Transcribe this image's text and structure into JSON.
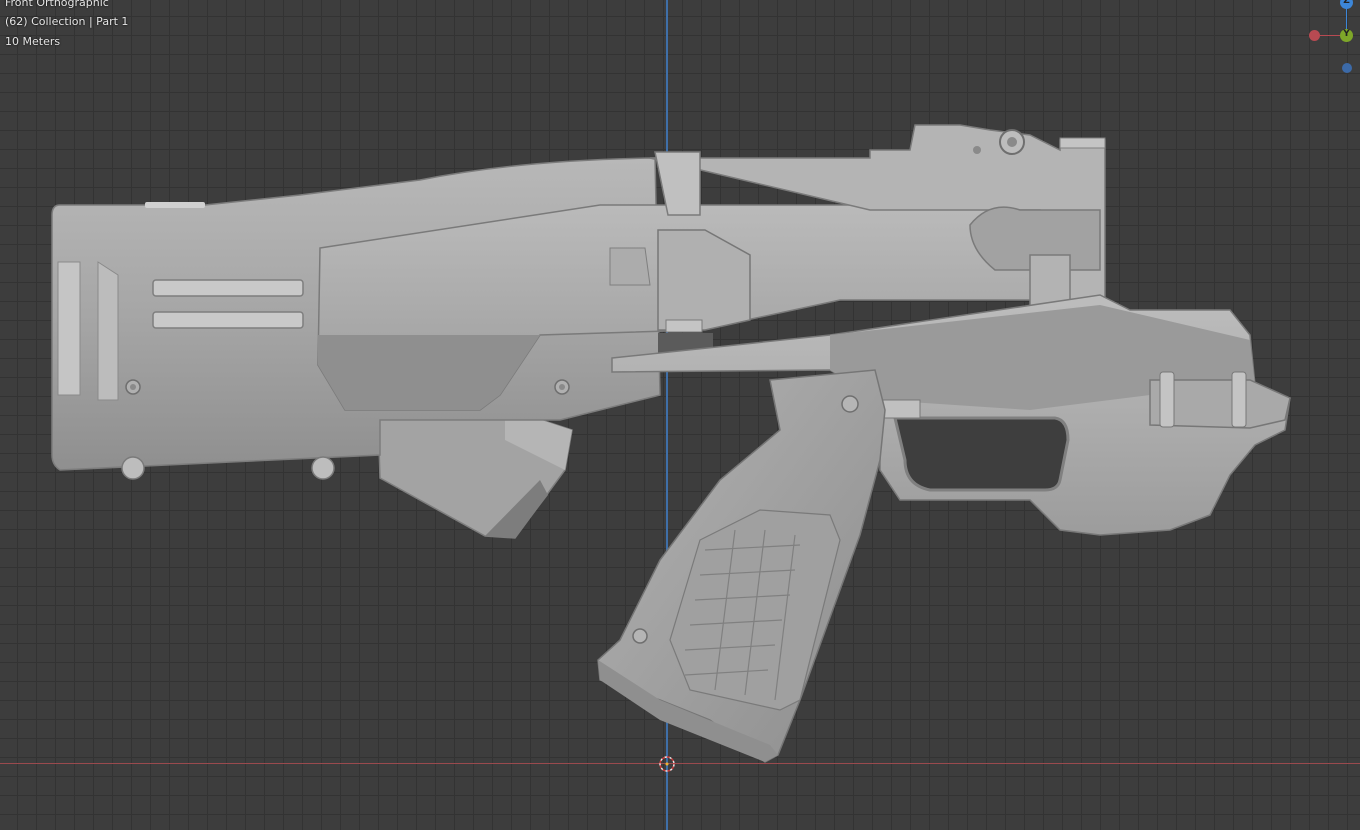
{
  "viewport": {
    "view_title": "Front Orthographic",
    "collection_info": "(62) Collection | Part 1",
    "scale_info": "10 Meters"
  },
  "gizmo": {
    "z_label": "Z",
    "y_label": "Y",
    "colors": {
      "x": "#b84a52",
      "y": "#7ea629",
      "z": "#3c86d8"
    }
  },
  "model": {
    "name": "Part 1",
    "color": "#a9a9a9"
  }
}
